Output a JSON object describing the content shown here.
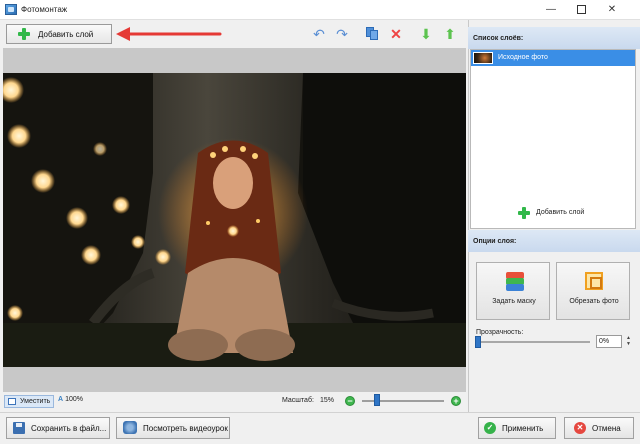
{
  "window": {
    "title": "Фотомонтаж",
    "minimize_glyph": "—",
    "close_glyph": "✕"
  },
  "toolbar": {
    "add_layer_label": "Добавить слой",
    "icons": [
      "undo-icon",
      "redo-icon",
      "copy-icon",
      "delete-icon",
      "move-down-icon",
      "move-up-icon"
    ],
    "undo_glyph": "↶",
    "redo_glyph": "↷",
    "delete_glyph": "✕",
    "down_glyph": "⬇",
    "up_glyph": "⬆"
  },
  "canvas": {
    "image": "photo: girl with glowing fairy lights by a tree at night"
  },
  "statusbar": {
    "fit_label": "Уместить",
    "zoom_100_label": "100%",
    "zoom_100_icon": "A",
    "scale_label": "Масштаб:",
    "scale_value": "15%",
    "zoom_minus": "−",
    "zoom_plus": "+"
  },
  "layers_panel": {
    "header": "Список слоёв:",
    "items": [
      {
        "name": "Исходное фото",
        "selected": true
      }
    ],
    "add_layer_label": "Добавить слой"
  },
  "options_panel": {
    "header": "Опции слоя:",
    "mask_button_label": "Задать маску",
    "crop_button_label": "Обрезать фото",
    "opacity_label": "Прозрачность:",
    "opacity_value": "0%",
    "spin_up": "▲",
    "spin_down": "▼"
  },
  "bottom": {
    "save_label": "Сохранить в файл...",
    "video_label": "Посмотреть видеоурок",
    "apply_label": "Применить",
    "apply_glyph": "✓",
    "cancel_label": "Отмена",
    "cancel_glyph": "✕"
  },
  "colors": {
    "accent": "#3a8ee6",
    "panel_header": "#c9d9ee",
    "annotation_arrow": "#e53935",
    "green": "#32b84a"
  }
}
